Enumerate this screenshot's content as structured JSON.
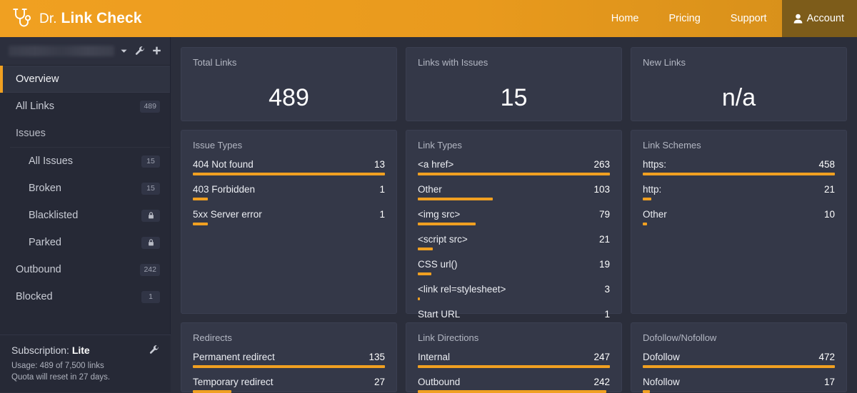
{
  "header": {
    "brand_prefix": "Dr.",
    "brand_name": "Link Check",
    "logo_icon": "stethoscope-icon",
    "nav": [
      {
        "label": "Home"
      },
      {
        "label": "Pricing"
      },
      {
        "label": "Support"
      }
    ],
    "account_label": "Account",
    "account_icon": "person-icon",
    "accent_color": "#f0a021",
    "account_bg": "#7d5c1a"
  },
  "sidebar": {
    "project_selector": {
      "project_name": "",
      "caret_icon": "chevron-down-icon",
      "settings_icon": "wrench-icon",
      "add_icon": "plus-icon"
    },
    "items": [
      {
        "label": "Overview",
        "badge": "",
        "active": true,
        "level": 0
      },
      {
        "label": "All Links",
        "badge": "489",
        "active": false,
        "level": 0
      },
      {
        "label": "Issues",
        "badge": "",
        "active": false,
        "level": 0,
        "group": true
      },
      {
        "label": "All Issues",
        "badge": "15",
        "active": false,
        "level": 1
      },
      {
        "label": "Broken",
        "badge": "15",
        "active": false,
        "level": 1
      },
      {
        "label": "Blacklisted",
        "badge": "lock",
        "active": false,
        "level": 1
      },
      {
        "label": "Parked",
        "badge": "lock",
        "active": false,
        "level": 1
      },
      {
        "label": "Outbound",
        "badge": "242",
        "active": false,
        "level": 0
      },
      {
        "label": "Blocked",
        "badge": "1",
        "active": false,
        "level": 0
      }
    ],
    "subscription": {
      "title_prefix": "Subscription: ",
      "plan": "Lite",
      "usage": "Usage: 489 of 7,500 links",
      "quota": "Quota will reset in 27 days.",
      "settings_icon": "wrench-icon"
    }
  },
  "stats": [
    {
      "title": "Total Links",
      "value": "489"
    },
    {
      "title": "Links with Issues",
      "value": "15"
    },
    {
      "title": "New Links",
      "value": "n/a"
    }
  ],
  "chart_data": [
    {
      "type": "bar",
      "title": "Issue Types",
      "orientation": "horizontal",
      "categories": [
        "404 Not found",
        "403 Forbidden",
        "5xx Server error"
      ],
      "values": [
        13,
        1,
        1
      ],
      "xlim": [
        0,
        13
      ],
      "grid": false,
      "legend": "none",
      "bar_color": "#f0a021"
    },
    {
      "type": "bar",
      "title": "Link Types",
      "orientation": "horizontal",
      "categories": [
        "<a href>",
        "Other",
        "<img src>",
        "<script src>",
        "CSS url()",
        "<link rel=stylesheet>",
        "Start URL"
      ],
      "values": [
        263,
        103,
        79,
        21,
        19,
        3,
        1
      ],
      "xlim": [
        0,
        263
      ],
      "grid": false,
      "legend": "none",
      "bar_color": "#f0a021"
    },
    {
      "type": "bar",
      "title": "Link Schemes",
      "orientation": "horizontal",
      "categories": [
        "https:",
        "http:",
        "Other"
      ],
      "values": [
        458,
        21,
        10
      ],
      "xlim": [
        0,
        458
      ],
      "grid": false,
      "legend": "none",
      "bar_color": "#f0a021"
    },
    {
      "type": "bar",
      "title": "Redirects",
      "orientation": "horizontal",
      "categories": [
        "Permanent redirect",
        "Temporary redirect"
      ],
      "values": [
        135,
        27
      ],
      "xlim": [
        0,
        135
      ],
      "grid": false,
      "legend": "none",
      "bar_color": "#f0a021"
    },
    {
      "type": "bar",
      "title": "Link Directions",
      "orientation": "horizontal",
      "categories": [
        "Internal",
        "Outbound"
      ],
      "values": [
        247,
        242
      ],
      "xlim": [
        0,
        247
      ],
      "grid": false,
      "legend": "none",
      "bar_color": "#f0a021"
    },
    {
      "type": "bar",
      "title": "Dofollow/Nofollow",
      "orientation": "horizontal",
      "categories": [
        "Dofollow",
        "Nofollow"
      ],
      "values": [
        472,
        17
      ],
      "xlim": [
        0,
        472
      ],
      "grid": false,
      "legend": "none",
      "bar_color": "#f0a021"
    }
  ]
}
